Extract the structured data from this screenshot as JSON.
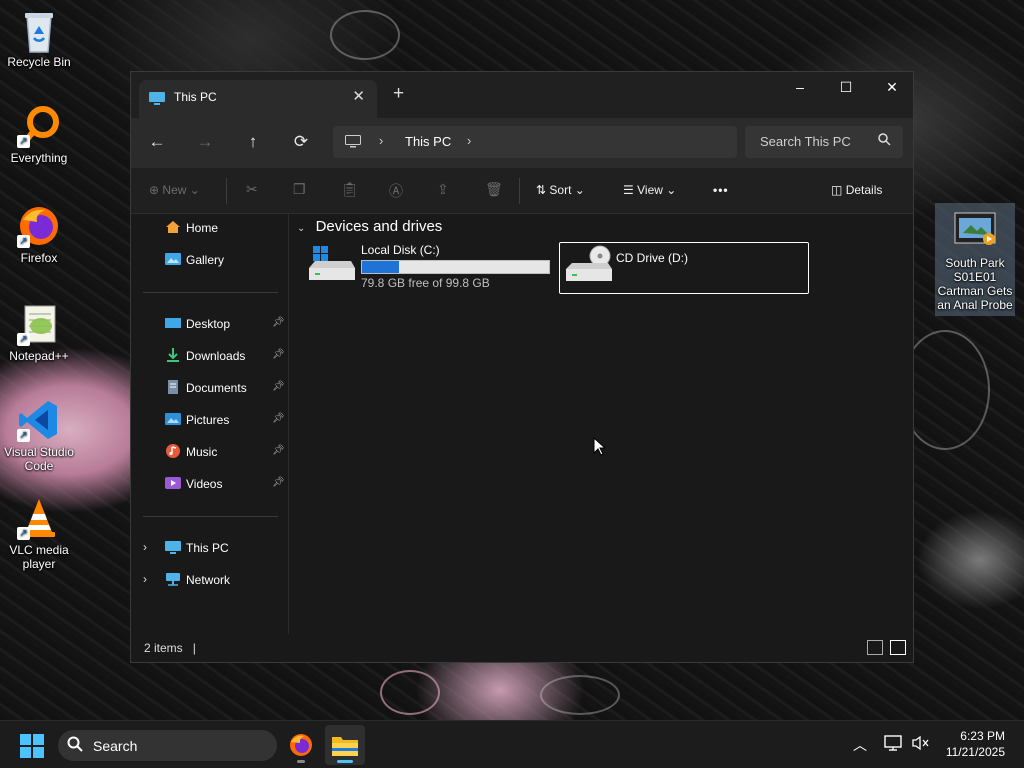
{
  "desktop": {
    "icons": [
      {
        "label": "Recycle Bin",
        "icon": "recycle-bin-icon"
      },
      {
        "label": "Everything",
        "icon": "everything-search-icon"
      },
      {
        "label": "Firefox",
        "icon": "firefox-icon"
      },
      {
        "label": "Notepad++",
        "icon": "notepad-plus-plus-icon"
      },
      {
        "label": "Visual Studio Code",
        "icon": "vscode-icon"
      },
      {
        "label": "VLC media player",
        "icon": "vlc-icon"
      }
    ],
    "right_icon": {
      "label": "South Park S01E01 Cartman Gets an Anal Probe",
      "icon": "video-file-icon"
    }
  },
  "window": {
    "tab_title": "This PC",
    "new_tab_symbol": "+",
    "controls": {
      "minimize": "–",
      "maximize": "☐",
      "close": "✕"
    }
  },
  "navbar": {
    "back": "←",
    "forward": "→",
    "up": "↑",
    "refresh": "⟳",
    "breadcrumb": "This PC",
    "search_placeholder": "Search This PC"
  },
  "commandbar": {
    "new_label": "New",
    "sort_label": "Sort",
    "view_label": "View",
    "more_label": "•••",
    "details_label": "Details"
  },
  "navpane": {
    "top": [
      {
        "label": "Home",
        "icon": "home-icon"
      },
      {
        "label": "Gallery",
        "icon": "gallery-icon"
      }
    ],
    "pinned": [
      {
        "label": "Desktop",
        "icon": "desktop-folder-icon"
      },
      {
        "label": "Downloads",
        "icon": "downloads-icon"
      },
      {
        "label": "Documents",
        "icon": "documents-icon"
      },
      {
        "label": "Pictures",
        "icon": "pictures-icon"
      },
      {
        "label": "Music",
        "icon": "music-icon"
      },
      {
        "label": "Videos",
        "icon": "videos-icon"
      }
    ],
    "tree": [
      {
        "label": "This PC",
        "icon": "this-pc-icon"
      },
      {
        "label": "Network",
        "icon": "network-icon"
      }
    ]
  },
  "content": {
    "group_header": "Devices and drives",
    "drives": [
      {
        "name": "Local Disk (C:)",
        "free_text": "79.8 GB free of 99.8 GB",
        "used_fraction": 0.2,
        "icon": "local-disk-icon",
        "selected": false
      },
      {
        "name": "CD Drive (D:)",
        "icon": "cd-drive-icon",
        "selected": true
      }
    ]
  },
  "statusbar": {
    "items_text": "2 items"
  },
  "taskbar": {
    "search_label": "Search",
    "apps": [
      "start-icon",
      "firefox-icon",
      "file-explorer-icon"
    ],
    "time": "6:23 PM",
    "date": "11/21/2025"
  },
  "colors": {
    "accent": "#1f72d6",
    "window_bg": "#191919",
    "toolbar_bg": "#2b2b2b"
  }
}
